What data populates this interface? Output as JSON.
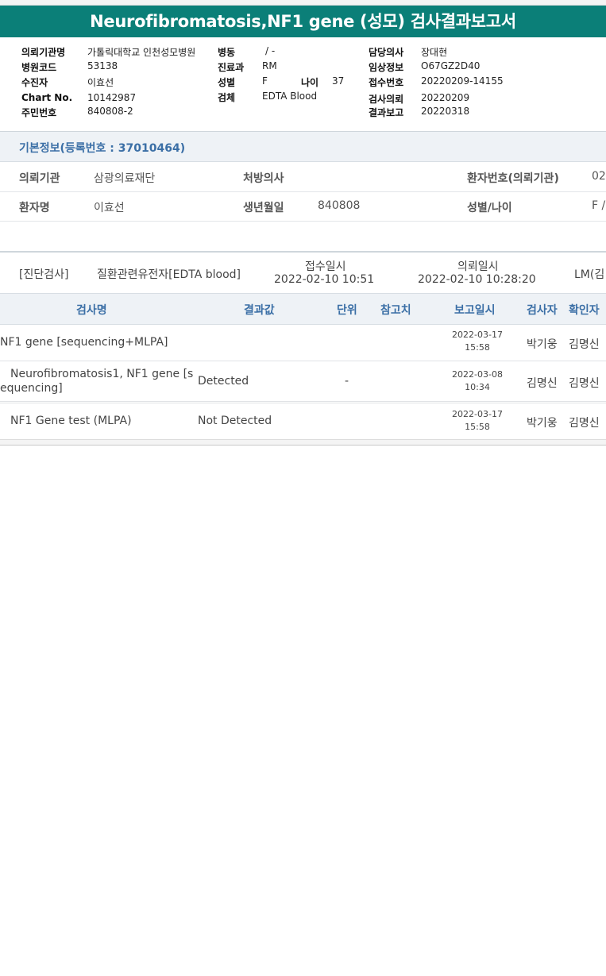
{
  "title": "Neurofibromatosis,NF1 gene (성모) 검사결과보고서",
  "header": {
    "institution_label": "의뢰기관명",
    "institution_value": "가톨릭대학교 인천성모병원",
    "hospital_code_label": "병원코드",
    "hospital_code_value": "53138",
    "examinee_label": "수진자",
    "examinee_value": "이효선",
    "chart_label": "Chart No.",
    "chart_value": "10142987",
    "rrn_label": "주민번호",
    "rrn_value": "840808-2",
    "ward_label": "병동",
    "ward_value": "/ -",
    "dept_label": "진료과",
    "dept_value": "RM",
    "sex_label": "성별",
    "sex_value": "F",
    "age_label": "나이",
    "age_value": "37",
    "specimen_label": "검체",
    "specimen_value": "EDTA Blood",
    "doctor_label": "담당의사",
    "doctor_value": "장대현",
    "clinical_label": "임상정보",
    "clinical_value": "O67GZ2D40",
    "receipt_label": "접수번호",
    "receipt_value": "20220209-14155",
    "request_label": "검사의뢰",
    "request_value": "20220209",
    "report_label": "결과보고",
    "report_value": "20220318"
  },
  "basic": {
    "section_title": "기본정보(등록번호 : 37010464)",
    "institution_label": "의뢰기관",
    "institution_value": "삼광의료재단",
    "prescriber_label": "처방의사",
    "prescriber_value": "",
    "patient_no_label": "환자번호(의뢰기관)",
    "patient_no_value": "02",
    "patient_name_label": "환자명",
    "patient_name_value": "이효선",
    "dob_label": "생년월일",
    "dob_value": "840808",
    "sex_age_label": "성별/나이",
    "sex_age_value": "F /"
  },
  "order": {
    "category": "[진단검사]",
    "test_name": "질환관련유전자[EDTA blood]",
    "received_label": "접수일시",
    "received_value": "2022-02-10  10:51",
    "requested_label": "의뢰일시",
    "requested_value": "2022-02-10  10:28:20",
    "lab": "LM(김"
  },
  "table": {
    "headers": {
      "name": "검사명",
      "result": "결과값",
      "unit": "단위",
      "ref": "참고치",
      "report_date": "보고일시",
      "tester": "검사자",
      "confirmer": "확인자"
    },
    "rows": [
      {
        "name": "NF1 gene [sequencing+MLPA]",
        "result": "",
        "unit": "",
        "date": "2022-03-17",
        "time": "15:58",
        "tester": "박기웅",
        "confirmer": "김명신"
      },
      {
        "name_line1": "Neurofibromatosis1, NF1 gene [s",
        "name_line2": "equencing]",
        "result": "Detected",
        "unit": "-",
        "date": "2022-03-08",
        "time": "10:34",
        "tester": "김명신",
        "confirmer": "김명신"
      },
      {
        "name": "NF1 Gene test (MLPA)",
        "result": "Not Detected",
        "unit": "",
        "date": "2022-03-17",
        "time": "15:58",
        "tester": "박기웅",
        "confirmer": "김명신"
      }
    ]
  }
}
